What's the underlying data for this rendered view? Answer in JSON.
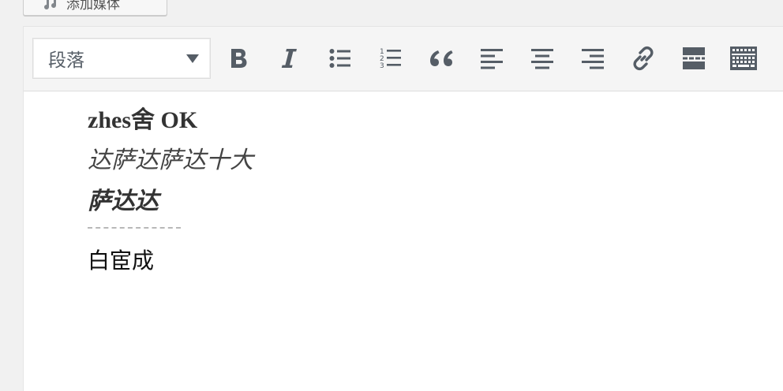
{
  "media_button": {
    "label": "添加媒体",
    "icon": "music-icon"
  },
  "toolbar": {
    "format_select": {
      "value": "段落"
    },
    "buttons": [
      {
        "name": "bold-button",
        "icon": "bold-icon"
      },
      {
        "name": "italic-button",
        "icon": "italic-icon"
      },
      {
        "name": "bullet-list-button",
        "icon": "bullet-list-icon"
      },
      {
        "name": "numbered-list-button",
        "icon": "numbered-list-icon"
      },
      {
        "name": "blockquote-button",
        "icon": "blockquote-icon"
      },
      {
        "name": "align-left-button",
        "icon": "align-left-icon"
      },
      {
        "name": "align-center-button",
        "icon": "align-center-icon"
      },
      {
        "name": "align-right-button",
        "icon": "align-right-icon"
      },
      {
        "name": "insert-link-button",
        "icon": "link-icon"
      },
      {
        "name": "read-more-button",
        "icon": "read-more-icon"
      },
      {
        "name": "toolbar-toggle-button",
        "icon": "keyboard-icon"
      }
    ]
  },
  "content": {
    "line1": "zhes舍 OK",
    "line2": "达萨达萨达十大",
    "line3": "萨达达",
    "line4": "白宦成"
  },
  "colors": {
    "icon": "#555d66",
    "toolbar_bg": "#f5f5f5",
    "editor_bg": "#ffffff"
  }
}
